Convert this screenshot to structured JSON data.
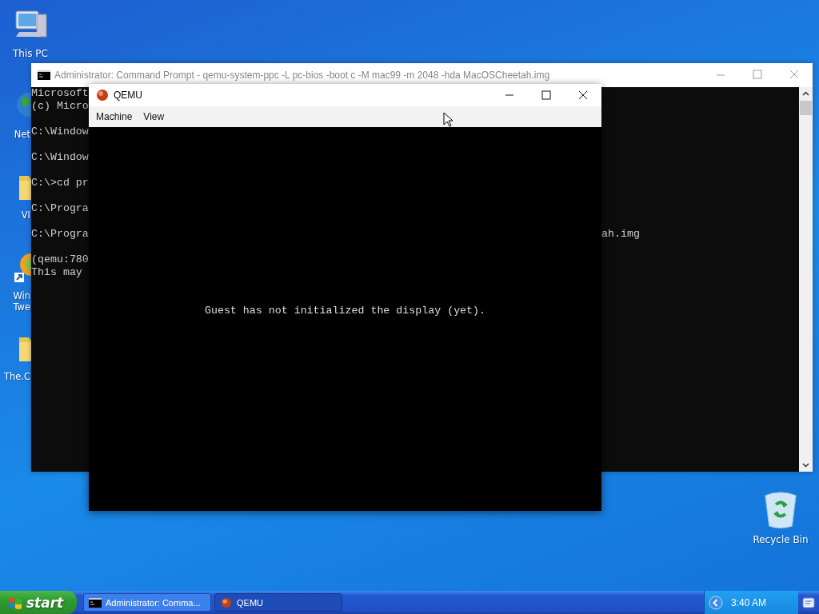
{
  "desktop_icons": [
    {
      "label": "This PC",
      "kind": "computer"
    },
    {
      "label": "Recycle Bin",
      "kind": "recycle"
    }
  ],
  "partly_hidden_icons": [
    {
      "label": "Net",
      "kind": "globe"
    },
    {
      "label": "VI",
      "kind": "folder"
    },
    {
      "label": "Win Twe",
      "kind": "shortcut"
    },
    {
      "label": "The.C",
      "kind": "folder"
    }
  ],
  "cmd_window": {
    "title": "Administrator: Command Prompt - qemu-system-ppc  -L pc-bios -boot c -M mac99 -m 2048 -hda MacOSCheetah.img",
    "blocks": [
      [
        {
          "text": "Microsoft"
        },
        {
          "text": "(c) Micro"
        }
      ],
      [
        {
          "text": "C:\\Window"
        }
      ],
      [
        {
          "text": "C:\\Window"
        }
      ],
      [
        {
          "text": "C:\\>cd pr"
        }
      ],
      [
        {
          "text": "C:\\Progra"
        }
      ],
      [
        {
          "text": "C:\\Progra",
          "tail": "ah.img"
        }
      ],
      [
        {
          "text": "(qemu:780"
        },
        {
          "text": "This may"
        }
      ]
    ]
  },
  "qemu_window": {
    "title": "QEMU",
    "menu": [
      "Machine",
      "View"
    ],
    "message": "Guest has not initialized the display (yet)."
  },
  "taskbar": {
    "start": "start",
    "tasks": [
      {
        "label": "Administrator: Comma...",
        "kind": "cmd",
        "selected": false
      },
      {
        "label": "QEMU",
        "kind": "qemu",
        "selected": true
      }
    ],
    "clock": "3:40 AM"
  }
}
